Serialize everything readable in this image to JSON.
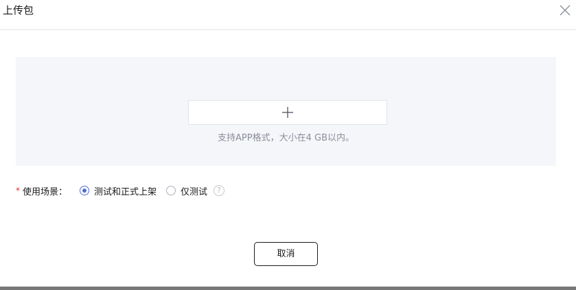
{
  "dialog": {
    "title": "上传包"
  },
  "upload": {
    "hint": "支持APP格式，大小在4 GB以内。"
  },
  "scene": {
    "required_mark": "*",
    "label": "使用场景：",
    "options": [
      {
        "label": "测试和正式上架",
        "checked": true
      },
      {
        "label": "仅测试",
        "checked": false
      }
    ],
    "help_glyph": "?"
  },
  "footer": {
    "cancel_label": "取消"
  },
  "icons": {
    "close": "close-icon",
    "add": "plus-icon",
    "help": "question-circle-icon"
  },
  "colors": {
    "accent": "#526ecc",
    "required": "#f5222d",
    "upload_bg": "#f5f6fa"
  }
}
